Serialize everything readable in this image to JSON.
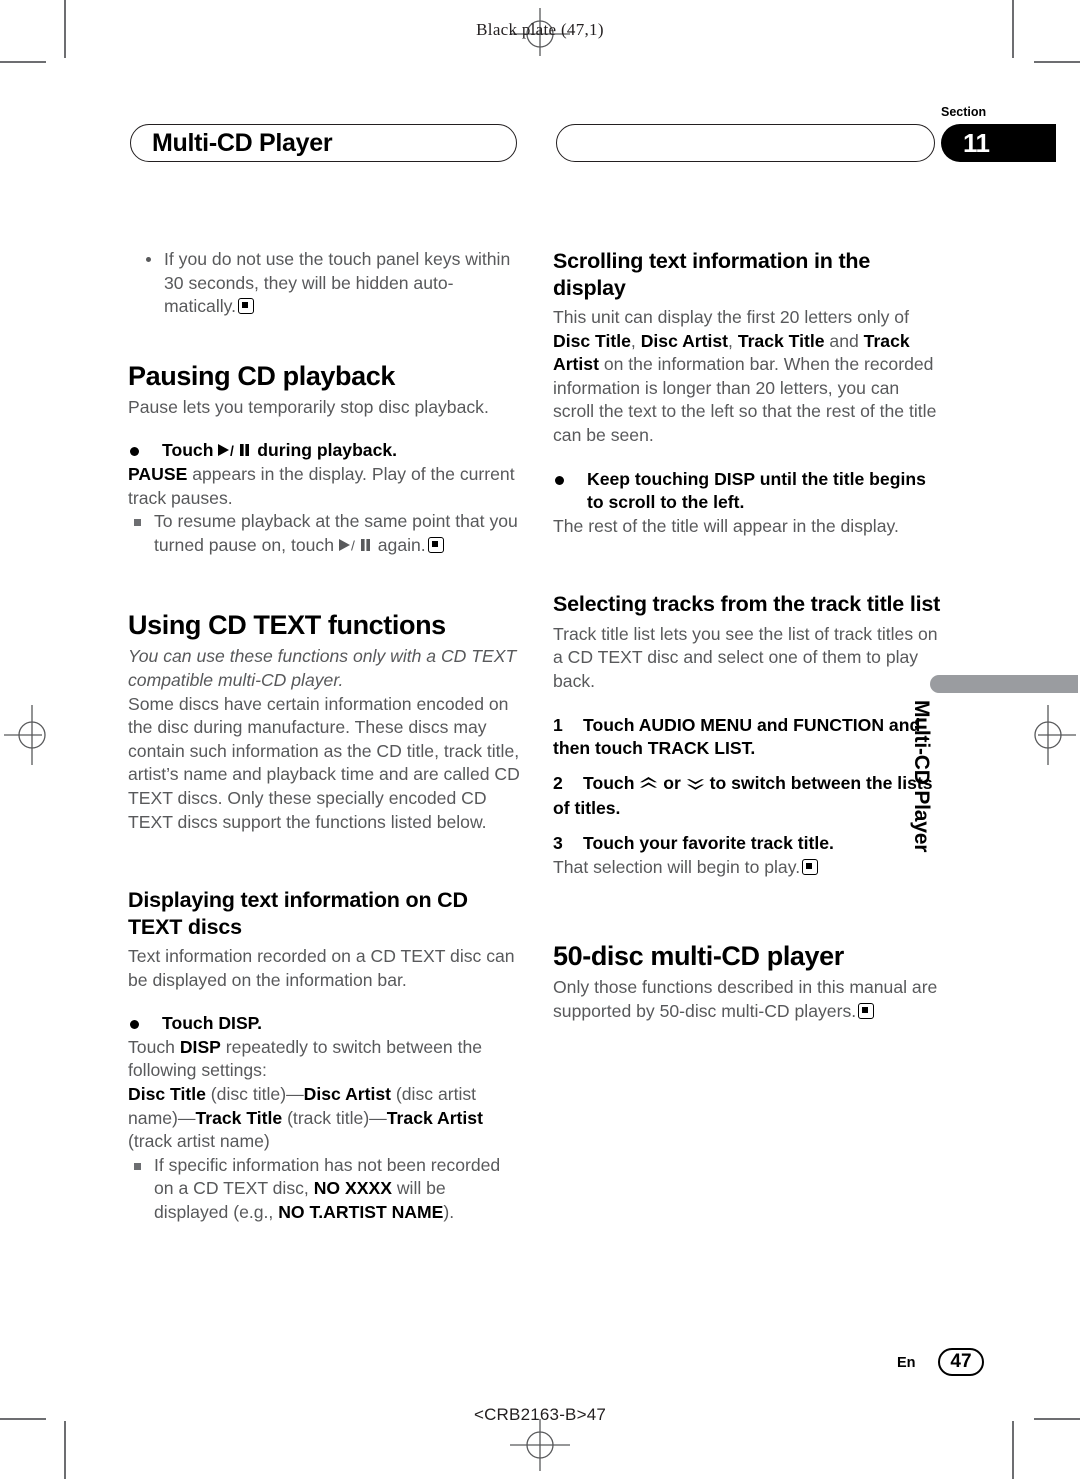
{
  "page": {
    "plate_text": "Black plate (47,1)",
    "part_number": "<CRB2163-B>47",
    "language_code": "En",
    "page_number": "47"
  },
  "header": {
    "chapter_title": "Multi-CD Player",
    "section_label": "Section",
    "section_number": "11"
  },
  "side_tab": {
    "label": "Multi-CD Player"
  },
  "left_column": {
    "intro_note": "If you do not use the touch panel keys within 30 seconds, they will be hidden auto-matically.",
    "pausing": {
      "heading": "Pausing CD playback",
      "intro": "Pause lets you temporarily stop disc playback.",
      "step_prefix": "Touch ",
      "step_suffix": " during playback.",
      "result_bold": "PAUSE",
      "result_text": " appears in the display. Play of the current track pauses.",
      "note_a": "To resume playback at the same point that you turned pause on, touch ",
      "note_b": " again."
    },
    "cdtext": {
      "heading": "Using CD TEXT functions",
      "italic_note": "You can use these functions only with a CD TEXT compatible multi-CD player.",
      "body": "Some discs have certain information encoded on the disc during manufacture. These discs may contain such information as the CD title, track title, artist’s name and playback time and are called CD TEXT discs. Only these specially encoded CD TEXT discs support the functions listed below."
    },
    "displaying": {
      "heading": "Displaying text information on CD TEXT discs",
      "body": "Text information recorded on a CD TEXT disc can be displayed on the information bar.",
      "step": "Touch DISP.",
      "after_step_a": "Touch ",
      "after_step_bold": "DISP",
      "after_step_b": " repeatedly to switch between the following settings:",
      "settings": {
        "s1_bold": "Disc Title",
        "s1_plain": " (disc title)—",
        "s2_bold": "Disc Artist",
        "s2_plain": " (disc artist name)—",
        "s3_bold": "Track Title",
        "s3_plain": " (track title)—",
        "s4_bold": "Track Artist",
        "s4_plain": " (track artist name)"
      },
      "note_a": "If specific information has not been recorded on a CD TEXT disc, ",
      "note_bold_1": "NO XXXX",
      "note_b": " will be displayed (e.g., ",
      "note_bold_2": "NO T.ARTIST NAME",
      "note_c": ")."
    }
  },
  "right_column": {
    "scrolling": {
      "heading": "Scrolling text information in the display",
      "body_1": "This unit can display the first 20 letters only of ",
      "kw_1": "Disc Title",
      "body_2": ", ",
      "kw_2": "Disc Artist",
      "body_3": ", ",
      "kw_3": "Track Title",
      "body_4": " and ",
      "kw_4": "Track Artist",
      "body_5": " on the information bar. When the recorded information is longer than 20 letters, you can scroll the text to the left so that the rest of the title can be seen.",
      "step": "Keep touching DISP until the title begins to scroll to the left.",
      "result": "The rest of the title will appear in the display."
    },
    "track_list": {
      "heading": "Selecting tracks from the track title list",
      "body": "Track title list lets you see the list of track titles on a CD TEXT disc and select one of them to play back.",
      "steps": [
        {
          "num": "1",
          "text": "Touch AUDIO MENU and FUNCTION and then touch TRACK LIST."
        },
        {
          "num": "2",
          "text_a": "Touch ",
          "text_b": " or ",
          "text_c": " to switch between the lists of titles."
        },
        {
          "num": "3",
          "text": "Touch your favorite track title."
        }
      ],
      "step3_result": "That selection will begin to play."
    },
    "fifty_disc": {
      "heading": "50-disc multi-CD player",
      "body": "Only those functions described in this manual are supported by 50-disc multi-CD players."
    }
  },
  "icons": {
    "play_pause": "play-pause-icon",
    "chevron_up_double": "chevron-up-double-icon",
    "chevron_down_double": "chevron-down-double-icon",
    "end_marker": "end-of-topic-marker",
    "registration": "registration-crosshair-icon"
  }
}
